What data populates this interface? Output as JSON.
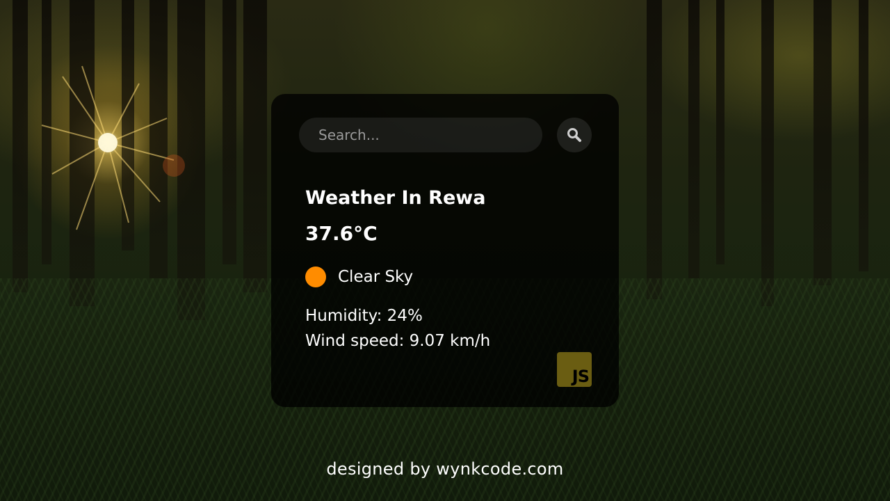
{
  "search": {
    "placeholder": "Search...",
    "icon": "search-icon"
  },
  "weather": {
    "title": "Weather In Rewa",
    "temperature": "37.6°C",
    "condition": "Clear Sky",
    "condition_icon": "sun-icon",
    "condition_color": "#ff8c00",
    "humidity": "Humidity: 24%",
    "wind": "Wind speed: 9.07 km/h"
  },
  "badge": {
    "text": "JS",
    "color": "#6a5d12"
  },
  "footer": {
    "credit": "designed by wynkcode.com"
  }
}
